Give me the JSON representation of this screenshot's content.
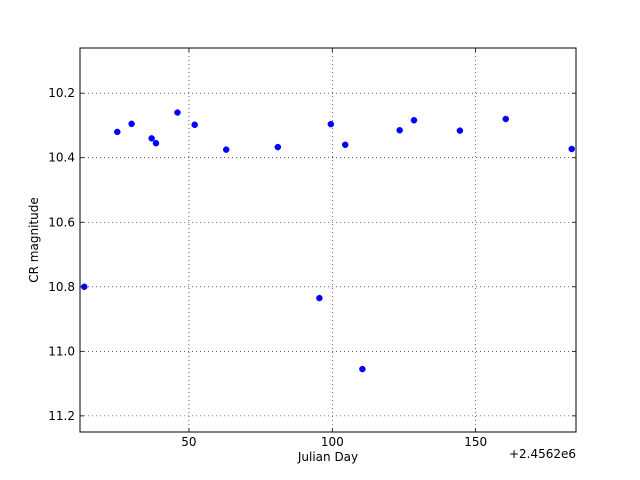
{
  "chart_data": {
    "type": "scatter",
    "xlabel": "Julian Day",
    "ylabel": "CR magnitude",
    "x_offset_label": "+2.4562e6",
    "xlim": [
      12,
      185
    ],
    "ylim": [
      11.25,
      10.06
    ],
    "y_inverted": true,
    "xticks": [
      50,
      100,
      150
    ],
    "xtick_labels": [
      "50",
      "100",
      "150"
    ],
    "yticks": [
      10.2,
      10.4,
      10.6,
      10.8,
      11.0,
      11.2
    ],
    "ytick_labels": [
      "10.2",
      "10.4",
      "10.6",
      "10.8",
      "11.0",
      "11.2"
    ],
    "grid": true,
    "marker_color": "#0000ff",
    "points": [
      {
        "x": 13.5,
        "y": 10.8
      },
      {
        "x": 25.0,
        "y": 10.32
      },
      {
        "x": 30.0,
        "y": 10.295
      },
      {
        "x": 37.0,
        "y": 10.34
      },
      {
        "x": 38.5,
        "y": 10.355
      },
      {
        "x": 46.0,
        "y": 10.26
      },
      {
        "x": 52.0,
        "y": 10.298
      },
      {
        "x": 63.0,
        "y": 10.375
      },
      {
        "x": 81.0,
        "y": 10.367
      },
      {
        "x": 95.5,
        "y": 10.835
      },
      {
        "x": 99.5,
        "y": 10.296
      },
      {
        "x": 104.5,
        "y": 10.36
      },
      {
        "x": 110.5,
        "y": 11.055
      },
      {
        "x": 123.5,
        "y": 10.315
      },
      {
        "x": 128.5,
        "y": 10.284
      },
      {
        "x": 144.5,
        "y": 10.316
      },
      {
        "x": 160.5,
        "y": 10.28
      },
      {
        "x": 183.5,
        "y": 10.373
      }
    ]
  }
}
